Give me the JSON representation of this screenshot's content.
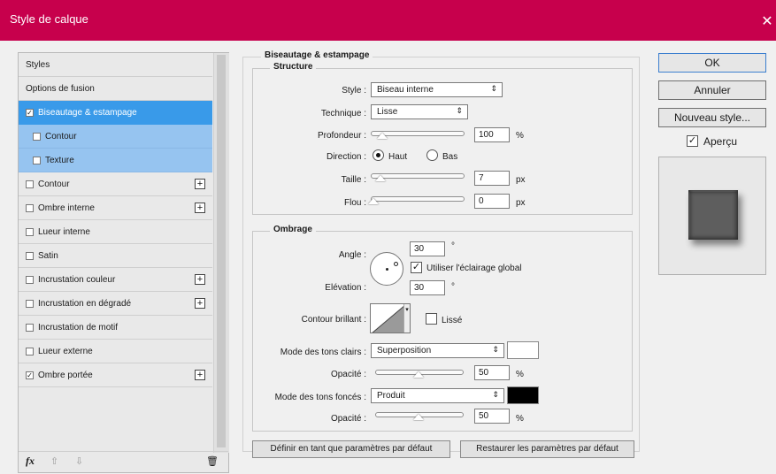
{
  "title": "Style de calque",
  "left_items": [
    {
      "label": "Styles",
      "checkbox": false,
      "plus": false,
      "state": "normal"
    },
    {
      "label": "Options de fusion",
      "checkbox": false,
      "plus": false,
      "state": "normal"
    },
    {
      "label": "Biseautage & estampage",
      "checkbox": true,
      "checked": true,
      "plus": false,
      "state": "selected"
    },
    {
      "label": "Contour",
      "checkbox": true,
      "checked": false,
      "plus": false,
      "state": "sub"
    },
    {
      "label": "Texture",
      "checkbox": true,
      "checked": false,
      "plus": false,
      "state": "sub"
    },
    {
      "label": "Contour",
      "checkbox": true,
      "checked": false,
      "plus": true,
      "state": "normal"
    },
    {
      "label": "Ombre interne",
      "checkbox": true,
      "checked": false,
      "plus": true,
      "state": "normal"
    },
    {
      "label": "Lueur interne",
      "checkbox": true,
      "checked": false,
      "plus": false,
      "state": "normal"
    },
    {
      "label": "Satin",
      "checkbox": true,
      "checked": false,
      "plus": false,
      "state": "normal"
    },
    {
      "label": "Incrustation couleur",
      "checkbox": true,
      "checked": false,
      "plus": true,
      "state": "normal"
    },
    {
      "label": "Incrustation en dégradé",
      "checkbox": true,
      "checked": false,
      "plus": true,
      "state": "normal"
    },
    {
      "label": "Incrustation de motif",
      "checkbox": true,
      "checked": false,
      "plus": false,
      "state": "normal"
    },
    {
      "label": "Lueur externe",
      "checkbox": true,
      "checked": false,
      "plus": false,
      "state": "normal"
    },
    {
      "label": "Ombre portée",
      "checkbox": true,
      "checked": true,
      "plus": true,
      "state": "normal"
    }
  ],
  "bottom_bar": {
    "fx": "fx",
    "up": "⇧",
    "down": "⇩",
    "trash": "🗑"
  },
  "bevel": {
    "section_title": "Biseautage & estampage",
    "structure_title": "Structure",
    "style_label": "Style :",
    "style_value": "Biseau interne",
    "technique_label": "Technique :",
    "technique_value": "Lisse",
    "depth_label": "Profondeur :",
    "depth_value": "100",
    "depth_unit": "%",
    "direction_label": "Direction :",
    "direction_up": "Haut",
    "direction_down": "Bas",
    "size_label": "Taille :",
    "size_value": "7",
    "size_unit": "px",
    "soften_label": "Flou :",
    "soften_value": "0",
    "soften_unit": "px"
  },
  "shading": {
    "title": "Ombrage",
    "angle_label": "Angle :",
    "angle_value": "30",
    "degree": "°",
    "global_light_label": "Utiliser l'éclairage global",
    "altitude_label": "Elévation :",
    "altitude_value": "30",
    "gloss_label": "Contour brillant :",
    "antialias_label": "Lissé",
    "highlight_label": "Mode des tons clairs :",
    "highlight_mode": "Superposition",
    "highlight_color": "#ffffff",
    "highlight_opacity_label": "Opacité :",
    "highlight_opacity": "50",
    "shadow_label": "Mode des tons foncés :",
    "shadow_mode": "Produit",
    "shadow_color": "#000000",
    "shadow_opacity_label": "Opacité :",
    "shadow_opacity": "50",
    "percent": "%"
  },
  "footer": {
    "make_default": "Définir en tant que paramètres par défaut",
    "reset_default": "Restaurer les paramètres par défaut"
  },
  "right": {
    "ok": "OK",
    "cancel": "Annuler",
    "new_style": "Nouveau style...",
    "preview_label": "Aperçu"
  },
  "colors": {
    "titlebar": "#c7004c",
    "selected": "#399ae9",
    "sub_selected": "#96c4f0"
  }
}
